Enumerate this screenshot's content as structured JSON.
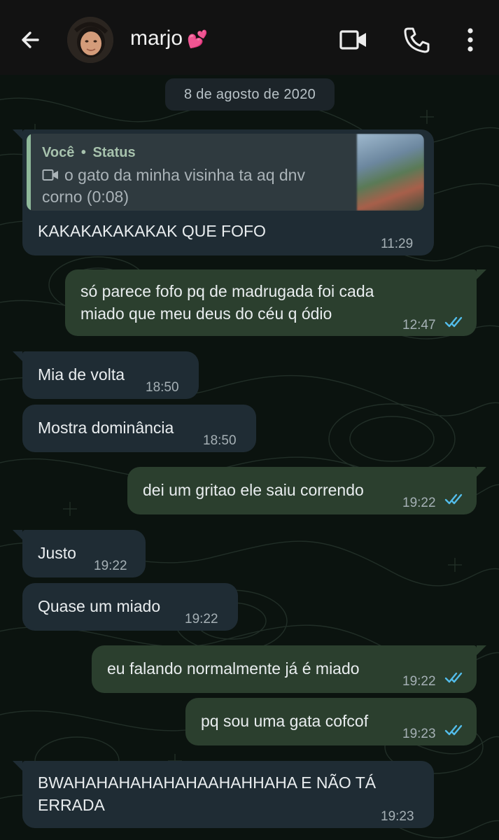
{
  "header": {
    "contact_name": "marjo",
    "name_emoji": "💕",
    "back_icon": "arrow-left-icon",
    "icons": [
      "video-call-icon",
      "phone-icon",
      "more-vert-icon"
    ]
  },
  "date_chip": "8 de agosto de 2020",
  "colors": {
    "header_bg": "#121212",
    "incoming_bubble": "#1f2c34",
    "outgoing_bubble": "#2b3f2e",
    "read_ticks": "#53bdeb"
  },
  "messages": [
    {
      "direction": "incoming",
      "reply": {
        "author": "Você",
        "separator": "•",
        "source": "Status",
        "media_icon": "video-icon",
        "line1": "o gato da minha visinha ta aq dnv",
        "line2": "corno (0:08)"
      },
      "lines": [
        "KAKAKAKAKAKAK QUE FOFO"
      ],
      "time": "11:29"
    },
    {
      "direction": "outgoing",
      "lines": [
        "só parece fofo pq de madrugada foi cada",
        "miado que meu deus do céu q ódio"
      ],
      "time": "12:47",
      "read": true
    },
    {
      "direction": "incoming",
      "lines": [
        "Mia de volta"
      ],
      "time": "18:50"
    },
    {
      "direction": "incoming",
      "lines": [
        "Mostra dominância"
      ],
      "time": "18:50"
    },
    {
      "direction": "outgoing",
      "lines": [
        "dei um gritao ele saiu correndo"
      ],
      "time": "19:22",
      "read": true
    },
    {
      "direction": "incoming",
      "lines": [
        "Justo"
      ],
      "time": "19:22"
    },
    {
      "direction": "incoming",
      "lines": [
        "Quase um miado"
      ],
      "time": "19:22"
    },
    {
      "direction": "outgoing",
      "lines": [
        "eu falando normalmente já é miado"
      ],
      "time": "19:22",
      "read": true
    },
    {
      "direction": "outgoing",
      "lines": [
        "pq sou uma gata cofcof"
      ],
      "time": "19:23",
      "read": true
    },
    {
      "direction": "incoming",
      "lines": [
        "BWAHAHAHAHAHAHAAHAHHAHA E NÃO TÁ",
        "ERRADA"
      ],
      "time": "19:23"
    }
  ]
}
